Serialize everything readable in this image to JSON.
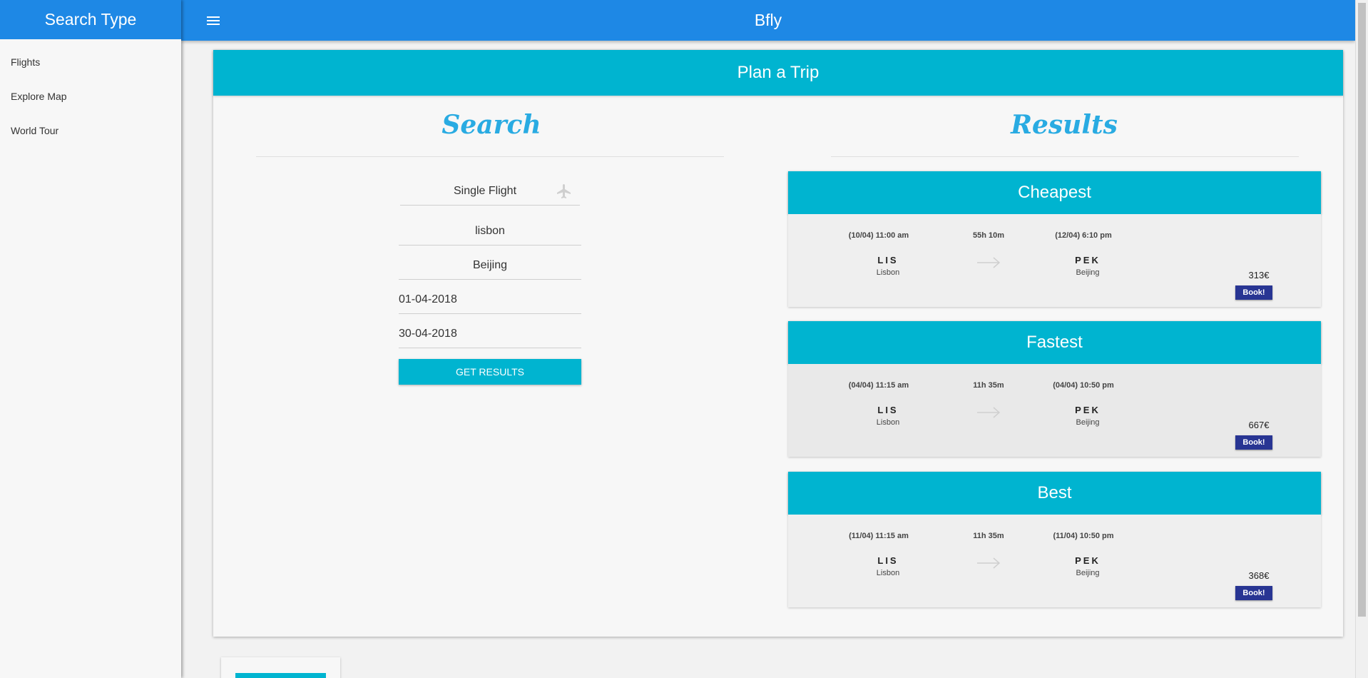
{
  "sidebar": {
    "title": "Search Type",
    "items": [
      {
        "label": "Flights"
      },
      {
        "label": "Explore Map"
      },
      {
        "label": "World Tour"
      }
    ]
  },
  "topbar": {
    "title": "Bfly",
    "menu_icon": "menu-icon"
  },
  "plan": {
    "header": "Plan a Trip",
    "search_title": "Search",
    "results_title": "Results"
  },
  "search": {
    "trip_type": "Single Flight",
    "trip_type_icon": "plane-icon",
    "origin": "lisbon",
    "destination": "Beijing",
    "depart_date": "01-04-2018",
    "return_date": "30-04-2018",
    "submit_label": "GET RESULTS"
  },
  "results": [
    {
      "title": "Cheapest",
      "depart_time": "(10/04) 11:00 am",
      "duration": "55h 10m",
      "arrive_time": "(12/04) 6:10 pm",
      "from_code": "LIS",
      "from_city": "Lisbon",
      "to_code": "PEK",
      "to_city": "Beijing",
      "price": "313€",
      "book_label": "Book!"
    },
    {
      "title": "Fastest",
      "depart_time": "(04/04) 11:15 am",
      "duration": "11h 35m",
      "arrive_time": "(04/04) 10:50 pm",
      "from_code": "LIS",
      "from_city": "Lisbon",
      "to_code": "PEK",
      "to_city": "Beijing",
      "price": "667€",
      "book_label": "Book!"
    },
    {
      "title": "Best",
      "depart_time": "(11/04) 11:15 am",
      "duration": "11h 35m",
      "arrive_time": "(11/04) 10:50 pm",
      "from_code": "LIS",
      "from_city": "Lisbon",
      "to_code": "PEK",
      "to_city": "Beijing",
      "price": "368€",
      "book_label": "Book!"
    }
  ],
  "colors": {
    "primary": "#1e88e5",
    "accent": "#00b4d0",
    "book": "#283593",
    "title": "#29abe2"
  }
}
